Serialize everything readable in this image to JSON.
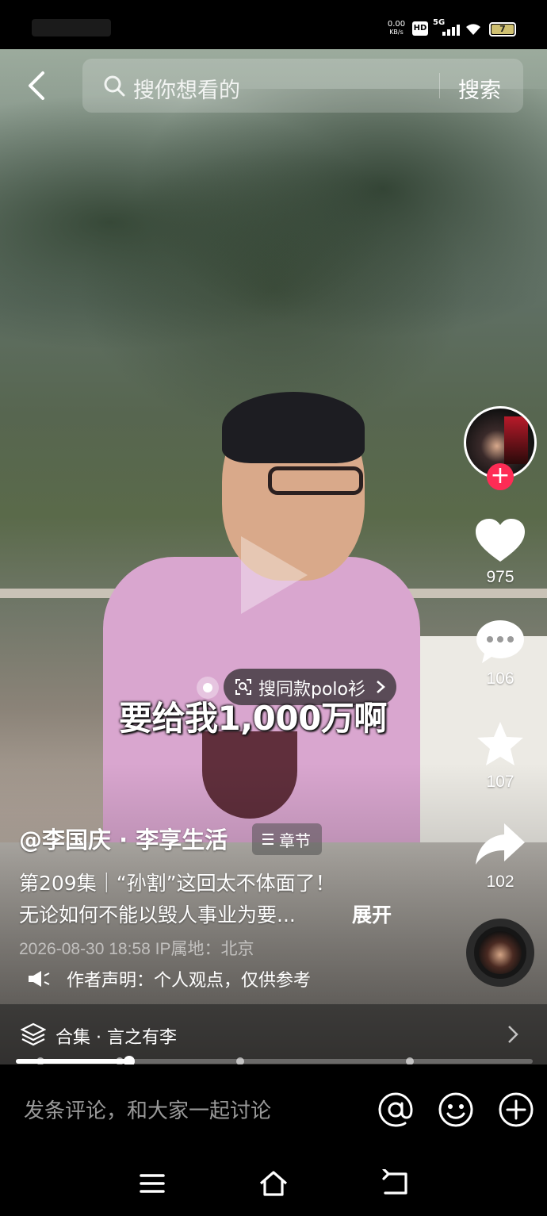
{
  "status_bar": {
    "net_rate_value": "0.00",
    "net_rate_unit": "KB/s",
    "hd_badge": "HD",
    "network": "5G",
    "battery": "7"
  },
  "search": {
    "placeholder": "搜你想看的",
    "button_label": "搜索"
  },
  "side_rail": {
    "likes": "975",
    "comments": "106",
    "favorites": "107",
    "shares": "102"
  },
  "product_tag": {
    "label": "搜同款polo衫"
  },
  "subtitle": "要给我1,000万啊",
  "post": {
    "author": "@李国庆 · 李享生活",
    "chapter_label": "章节",
    "desc_line1": "第209集｜“孙割”这回太不体面了！",
    "desc_line2": "无论如何不能以毁人事业为要...",
    "expand_label": "展开",
    "meta": "2026-08-30 18:58  IP属地：北京",
    "statement": "作者声明：个人观点，仅供参考"
  },
  "collection": {
    "label": "合集 · 言之有李"
  },
  "progress": {
    "played_fraction": 0.22
  },
  "comment_bar": {
    "placeholder": "发条评论，和大家一起讨论"
  },
  "colors": {
    "follow": "#fe2c55",
    "battery": "#cfc071"
  }
}
